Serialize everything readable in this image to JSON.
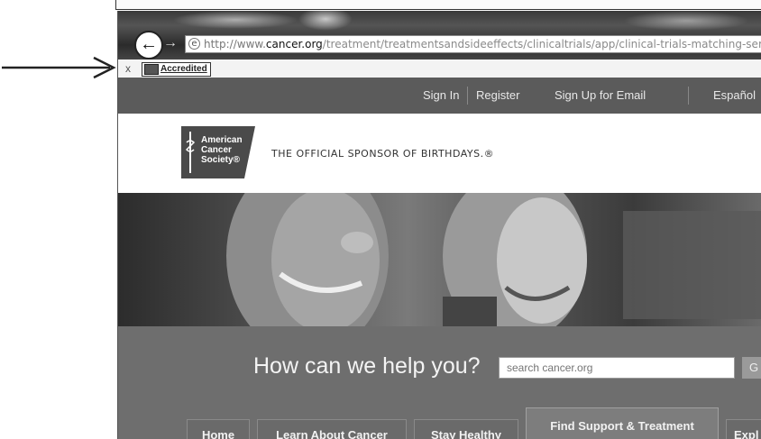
{
  "browser": {
    "url": {
      "protocol": "http://www.",
      "domain": "cancer.org",
      "path": "/treatment/treatmentsandsideeffects/clinicaltrials/app/clinical-trials-matching-service"
    },
    "back_icon": "back-arrow-icon",
    "forward_icon": "forward-arrow-icon",
    "favorites_bar": {
      "close_label": "x",
      "badge_label": "Accredited"
    }
  },
  "site": {
    "top_nav": {
      "sign_in": "Sign In",
      "register": "Register",
      "sign_up_email": "Sign Up for Email",
      "espanol": "Español"
    },
    "logo": {
      "line1": "American",
      "line2": "Cancer",
      "line3": "Society®"
    },
    "tagline": "THE OFFICIAL SPONSOR OF BIRTHDAYS.®",
    "search": {
      "prompt": "How can we help you?",
      "placeholder": "search cancer.org",
      "go_label": "G"
    },
    "nav_tabs": [
      "Home",
      "Learn About Cancer",
      "Stay Healthy",
      "Find Support & Treatment",
      "Expl"
    ]
  },
  "colors": {
    "top_nav_bg": "#5b5b5b",
    "search_band_bg": "#6e6e6e"
  }
}
